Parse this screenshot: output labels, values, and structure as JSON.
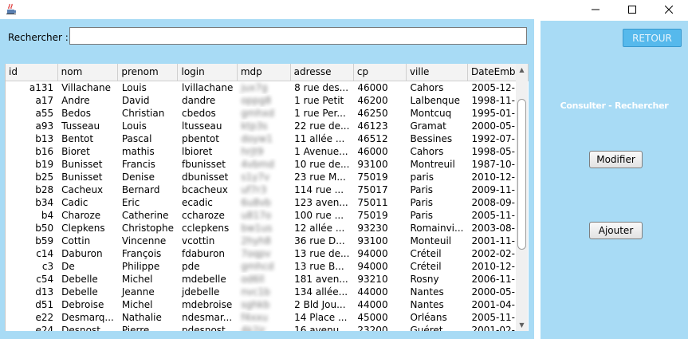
{
  "window": {
    "app_icon": "java-cup-icon",
    "controls": [
      "minimize-icon",
      "maximize-icon",
      "close-icon"
    ]
  },
  "search": {
    "label": "Rechercher :",
    "value": ""
  },
  "table": {
    "columns": [
      "id",
      "nom",
      "prenom",
      "login",
      "mdp",
      "adresse",
      "cp",
      "ville",
      "DateEmb..."
    ],
    "rows": [
      [
        "a131",
        "Villachane",
        "Louis",
        "lvillachane",
        "jux7g",
        "8 rue des...",
        "46000",
        "Cahors",
        "2005-12-..."
      ],
      [
        "a17",
        "Andre",
        "David",
        "dandre",
        "oppg8",
        "1 rue Petit",
        "46200",
        "Lalbenque",
        "1998-11-..."
      ],
      [
        "a55",
        "Bedos",
        "Christian",
        "cbedos",
        "gmhxd",
        "1 rue Per...",
        "46250",
        "Montcuq",
        "1995-01-..."
      ],
      [
        "a93",
        "Tusseau",
        "Louis",
        "ltusseau",
        "ktp3s",
        "22 rue de...",
        "46123",
        "Gramat",
        "2000-05-..."
      ],
      [
        "b13",
        "Bentot",
        "Pascal",
        "pbentot",
        "doyw1",
        "11 allée ...",
        "46512",
        "Bessines",
        "1992-07-..."
      ],
      [
        "b16",
        "Bioret",
        "mathis",
        "lbioret",
        "hrjt9",
        "1 Avenue...",
        "46000",
        "Cahors",
        "1998-05-..."
      ],
      [
        "b19",
        "Bunisset",
        "Francis",
        "fbunisset",
        "4vbmd",
        "10 rue de...",
        "93100",
        "Montreuil",
        "1987-10-..."
      ],
      [
        "b25",
        "Bunisset",
        "Denise",
        "dbunisset",
        "s1y7v",
        "23 rue M...",
        "75019",
        "paris",
        "2010-12-..."
      ],
      [
        "b28",
        "Cacheux",
        "Bernard",
        "bcacheux",
        "uf7r3",
        "114 rue ...",
        "75017",
        "Paris",
        "2009-11-..."
      ],
      [
        "b34",
        "Cadic",
        "Eric",
        "ecadic",
        "6u8vb",
        "123 aven...",
        "75011",
        "Paris",
        "2008-09-..."
      ],
      [
        "b4",
        "Charoze",
        "Catherine",
        "ccharoze",
        "u817o",
        "100 rue ...",
        "75019",
        "Paris",
        "2005-11-..."
      ],
      [
        "b50",
        "Clepkens",
        "Christophe",
        "cclepkens",
        "bw1us",
        "12 allée ...",
        "93230",
        "Romainvi...",
        "2003-08-..."
      ],
      [
        "b59",
        "Cottin",
        "Vincenne",
        "vcottin",
        "2hyh8",
        "36 rue D...",
        "93100",
        "Monteuil",
        "2001-11-..."
      ],
      [
        "c14",
        "Daburon",
        "François",
        "fdaburon",
        "7oqpv",
        "13 rue de...",
        "94000",
        "Créteil",
        "2002-02-..."
      ],
      [
        "c3",
        "De",
        "Philippe",
        "pde",
        "gmhcd",
        "13 rue B...",
        "94000",
        "Créteil",
        "2010-12-..."
      ],
      [
        "c54",
        "Debelle",
        "Michel",
        "mdebelle",
        "od6ll",
        "181 aven...",
        "93210",
        "Rosny",
        "2006-11-..."
      ],
      [
        "d13",
        "Debelle",
        "Jeanne",
        "jdebelle",
        "nvc1b",
        "134 allée...",
        "44000",
        "Nantes",
        "2000-05-..."
      ],
      [
        "d51",
        "Debroise",
        "Michel",
        "mdebroise",
        "sghkb",
        "2 Bld Jou...",
        "44000",
        "Nantes",
        "2001-04-..."
      ],
      [
        "e22",
        "Desmarq...",
        "Nathalie",
        "ndesmar...",
        "f4xxu",
        "14 Place ...",
        "45000",
        "Orléans",
        "2005-11-..."
      ],
      [
        "e24",
        "Desnost",
        "Pierre",
        "pdesnost",
        "4k2jr",
        "16 avenu...",
        "23200",
        "Guéret",
        "2001-02-..."
      ]
    ]
  },
  "right_panel": {
    "retour_label": "RETOUR",
    "title": "Consulter - Rechercher",
    "modifier_label": "Modifier",
    "ajouter_label": "Ajouter"
  },
  "colors": {
    "panel_bg": "#a8dbf5",
    "retour_bg": "#56b9ec",
    "header_bg": "#f3f3f3"
  }
}
